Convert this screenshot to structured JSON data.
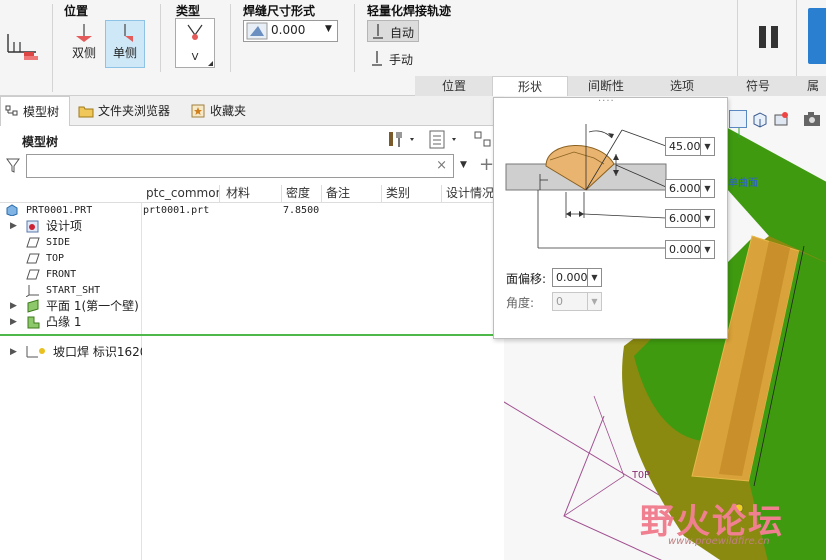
{
  "ribbon": {
    "position_group": {
      "title": "位置",
      "double_label": "双侧",
      "single_label": "单侧"
    },
    "type_group": {
      "title": "类型",
      "type_letter": "V"
    },
    "size_group": {
      "title": "焊缝尺寸形式",
      "value": "0.000"
    },
    "trajectory_group": {
      "title": "轻量化焊接轨迹",
      "auto_label": "自动",
      "manual_label": "手动"
    },
    "tabs": [
      "位置",
      "形状",
      "间断性",
      "选项",
      "符号",
      "属"
    ],
    "active_tab": "形状"
  },
  "nav": {
    "tabs": [
      "模型树",
      "文件夹浏览器",
      "收藏夹"
    ],
    "tree_title": "模型树",
    "search_placeholder": "",
    "columns": [
      "ptc_common_r",
      "材料",
      "密度",
      "备注",
      "类别",
      "设计情况"
    ],
    "rows": [
      {
        "label": "PRT0001.PRT",
        "ptc": "prt0001.prt",
        "density": "7.8500"
      },
      {
        "label": "设计项"
      },
      {
        "label": "SIDE"
      },
      {
        "label": "TOP"
      },
      {
        "label": "FRONT"
      },
      {
        "label": "START_SHT"
      },
      {
        "label": "平面 1(第一个壁)"
      },
      {
        "label": "凸缘 1"
      },
      {
        "label": "坡口焊 标识1620"
      }
    ]
  },
  "popup": {
    "values": [
      "45.00",
      "6.000",
      "6.000",
      "0.000"
    ],
    "face_offset_label": "面偏移:",
    "face_offset_value": "0.000",
    "angle_label": "角度:",
    "angle_value": "0"
  },
  "viewport": {
    "surface_label": "单曲面",
    "plane_label": "TOP",
    "watermark_title": "野火论坛",
    "watermark_url": "www.proewildfire.cn"
  },
  "colors": {
    "green": "#3f9a10",
    "olive": "#8a8a10",
    "weld": "#d9a23a",
    "accent": "#2b7fd0"
  }
}
